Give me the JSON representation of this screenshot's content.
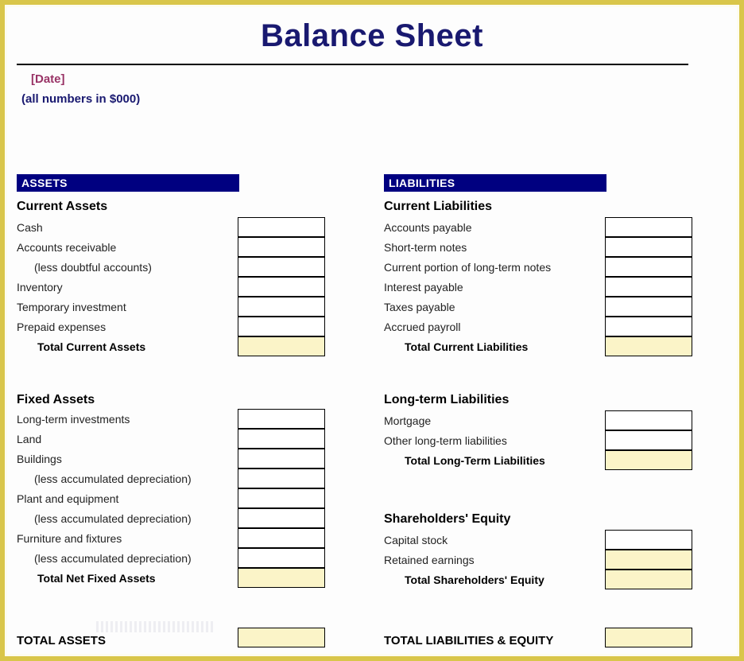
{
  "document": {
    "title": "Balance Sheet",
    "date_placeholder": "[Date]",
    "units_note": "(all numbers in $000)"
  },
  "colors": {
    "title_navy": "#191970",
    "banner_navy": "#000080",
    "date_purple": "#993366",
    "total_fill": "#fbf4c8",
    "page_border_gold": "#d9c64a"
  },
  "assets": {
    "banner": "ASSETS",
    "current": {
      "heading": "Current Assets",
      "rows": [
        {
          "label": "Cash",
          "indent": false,
          "total": false,
          "filled": false
        },
        {
          "label": "Accounts receivable",
          "indent": false,
          "total": false,
          "filled": false
        },
        {
          "label": "(less doubtful accounts)",
          "indent": true,
          "total": false,
          "filled": false
        },
        {
          "label": "Inventory",
          "indent": false,
          "total": false,
          "filled": false
        },
        {
          "label": "Temporary investment",
          "indent": false,
          "total": false,
          "filled": false
        },
        {
          "label": "Prepaid expenses",
          "indent": false,
          "total": false,
          "filled": false
        },
        {
          "label": "Total Current Assets",
          "indent": false,
          "total": true,
          "filled": true
        }
      ]
    },
    "fixed": {
      "heading": "Fixed Assets",
      "rows": [
        {
          "label": "Long-term investments",
          "indent": false,
          "total": false,
          "filled": false
        },
        {
          "label": "Land",
          "indent": false,
          "total": false,
          "filled": false
        },
        {
          "label": "Buildings",
          "indent": false,
          "total": false,
          "filled": false
        },
        {
          "label": "(less accumulated depreciation)",
          "indent": true,
          "total": false,
          "filled": false
        },
        {
          "label": "Plant and equipment",
          "indent": false,
          "total": false,
          "filled": false
        },
        {
          "label": "(less accumulated depreciation)",
          "indent": true,
          "total": false,
          "filled": false
        },
        {
          "label": "Furniture and fixtures",
          "indent": false,
          "total": false,
          "filled": false
        },
        {
          "label": "(less accumulated depreciation)",
          "indent": true,
          "total": false,
          "filled": false
        },
        {
          "label": "Total Net Fixed Assets",
          "indent": false,
          "total": true,
          "filled": true
        }
      ]
    },
    "grand_total_label": "TOTAL ASSETS"
  },
  "liabilities": {
    "banner": "LIABILITIES",
    "current": {
      "heading": "Current Liabilities",
      "rows": [
        {
          "label": "Accounts payable",
          "indent": false,
          "total": false,
          "filled": false
        },
        {
          "label": "Short-term notes",
          "indent": false,
          "total": false,
          "filled": false
        },
        {
          "label": "Current portion of long-term notes",
          "indent": false,
          "total": false,
          "filled": false
        },
        {
          "label": "Interest payable",
          "indent": false,
          "total": false,
          "filled": false
        },
        {
          "label": "Taxes payable",
          "indent": false,
          "total": false,
          "filled": false
        },
        {
          "label": "Accrued payroll",
          "indent": false,
          "total": false,
          "filled": false
        },
        {
          "label": "Total Current Liabilities",
          "indent": false,
          "total": true,
          "filled": true
        }
      ]
    },
    "longterm": {
      "heading": "Long-term Liabilities",
      "rows": [
        {
          "label": "Mortgage",
          "indent": false,
          "total": false,
          "filled": false
        },
        {
          "label": "Other long-term liabilities",
          "indent": false,
          "total": false,
          "filled": false
        },
        {
          "label": "Total Long-Term Liabilities",
          "indent": false,
          "total": true,
          "filled": true
        }
      ]
    },
    "equity": {
      "heading": "Shareholders' Equity",
      "rows": [
        {
          "label": "Capital stock",
          "indent": false,
          "total": false,
          "filled": false
        },
        {
          "label": "Retained earnings",
          "indent": false,
          "total": false,
          "filled": true
        },
        {
          "label": "Total Shareholders' Equity",
          "indent": false,
          "total": true,
          "filled": true
        }
      ]
    },
    "grand_total_label": "TOTAL LIABILITIES & EQUITY"
  }
}
